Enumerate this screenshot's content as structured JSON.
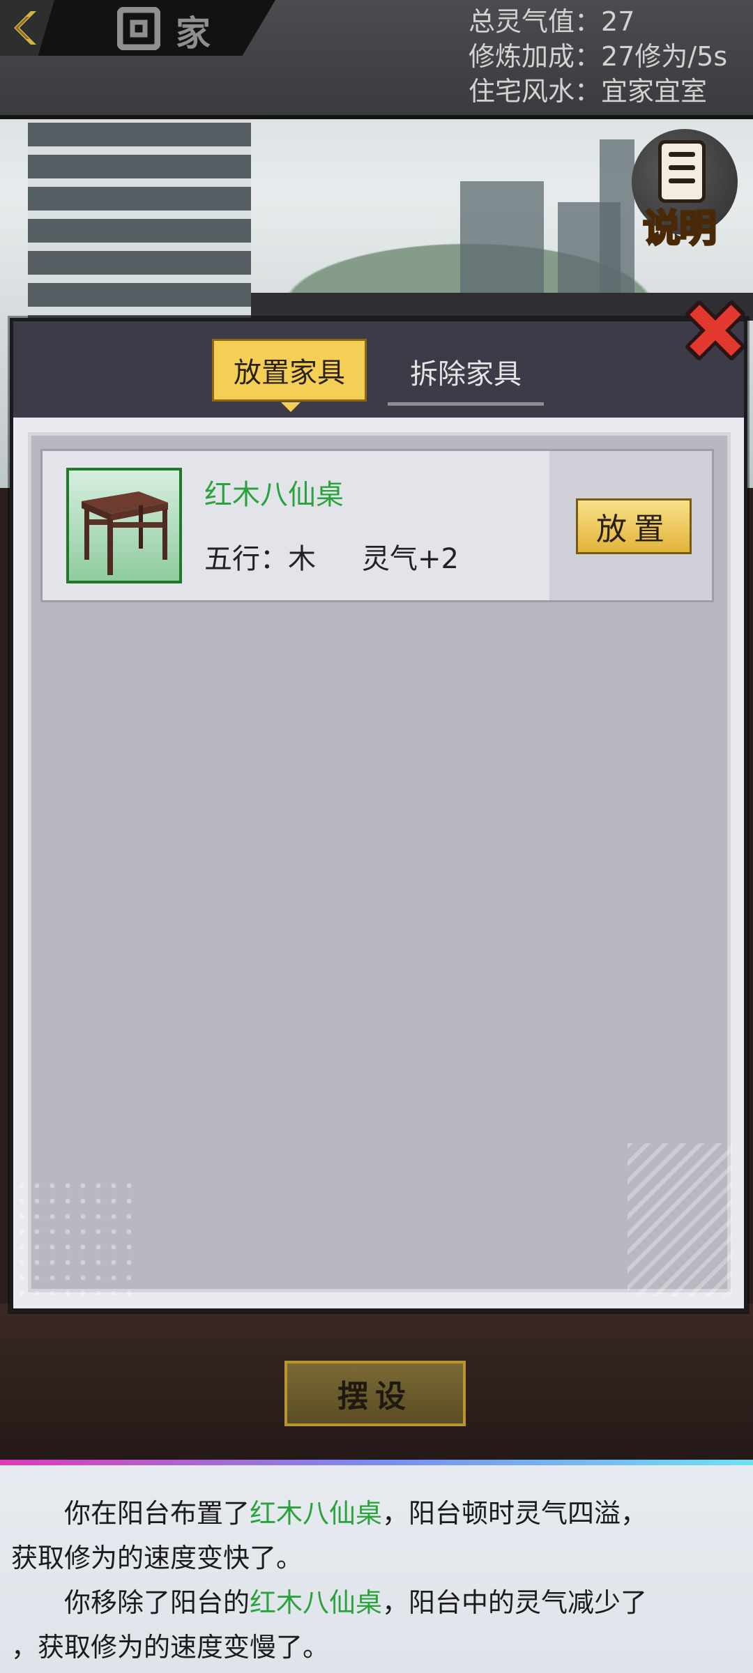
{
  "header": {
    "title": "家",
    "stats": [
      {
        "label": "总灵气值：",
        "value": "27"
      },
      {
        "label": "修炼加成：",
        "value": "27修为/5s"
      },
      {
        "label": "住宅风水：",
        "value": "宜家宜室"
      }
    ]
  },
  "explain_button": {
    "label": "说明"
  },
  "dialog": {
    "tabs": [
      {
        "label": "放置家具",
        "active": true
      },
      {
        "label": "拆除家具",
        "active": false
      }
    ],
    "items": [
      {
        "name": "红木八仙桌",
        "element": "五行：木",
        "qi": "灵气+2",
        "action_label": "放置"
      }
    ]
  },
  "arrange_button": {
    "label": "摆设"
  },
  "log": {
    "lines": [
      {
        "pre": "　　你在阳台布置了",
        "highlight": "红木八仙桌",
        "post": "，阳台顿时灵气四溢，"
      },
      {
        "pre": "获取修为的速度变快了。",
        "highlight": "",
        "post": ""
      },
      {
        "pre": "　　你移除了阳台的",
        "highlight": "红木八仙桌",
        "post": "，阳台中的灵气减少了"
      },
      {
        "pre": "，获取修为的速度变慢了。",
        "highlight": "",
        "post": ""
      }
    ]
  },
  "colors": {
    "accent_gold": "#f5cf55",
    "highlight_green": "#2aa33e",
    "close_red": "#e2382e"
  }
}
